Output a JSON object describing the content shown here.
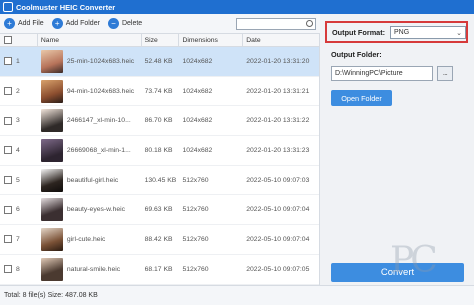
{
  "app": {
    "title": "Coolmuster HEIC Converter"
  },
  "toolbar": {
    "add_file": "Add File",
    "add_folder": "Add Folder",
    "delete": "Delete",
    "search_placeholder": ""
  },
  "table": {
    "headers": {
      "name": "Name",
      "size": "Size",
      "dimensions": "Dimensions",
      "date": "Date"
    },
    "rows": [
      {
        "index": "1",
        "name": "25-min-1024x683.heic",
        "size": "52.48 KB",
        "dimensions": "1024x682",
        "date": "2022-01-20 13:31:20"
      },
      {
        "index": "2",
        "name": "94-min-1024x683.heic",
        "size": "73.74 KB",
        "dimensions": "1024x682",
        "date": "2022-01-20 13:31:21"
      },
      {
        "index": "3",
        "name": "2466147_xl-min-10...",
        "size": "86.70 KB",
        "dimensions": "1024x682",
        "date": "2022-01-20 13:31:22"
      },
      {
        "index": "4",
        "name": "26669068_xl-min-1...",
        "size": "80.18 KB",
        "dimensions": "1024x682",
        "date": "2022-01-20 13:31:23"
      },
      {
        "index": "5",
        "name": "beautiful-girl.heic",
        "size": "130.45 KB",
        "dimensions": "512x760",
        "date": "2022-05-10 09:07:03"
      },
      {
        "index": "6",
        "name": "beauty-eyes-w.heic",
        "size": "69.63 KB",
        "dimensions": "512x760",
        "date": "2022-05-10 09:07:04"
      },
      {
        "index": "7",
        "name": "girl-cute.heic",
        "size": "88.42 KB",
        "dimensions": "512x760",
        "date": "2022-05-10 09:07:04"
      },
      {
        "index": "8",
        "name": "natural-smile.heic",
        "size": "68.17 KB",
        "dimensions": "512x760",
        "date": "2022-05-10 09:07:05"
      }
    ]
  },
  "status": {
    "text": "Total: 8 file(s) Size: 487.08 KB"
  },
  "panel": {
    "output_format_label": "Output Format:",
    "output_format_value": "PNG",
    "output_folder_label": "Output Folder:",
    "output_folder_path": "D:\\WinningPC\\Picture",
    "browse_label": "...",
    "open_folder_label": "Open Folder",
    "convert_label": "Convert"
  },
  "watermark": "PC",
  "colors": {
    "titlebar": "#1f6fd0",
    "accent": "#3d8de0",
    "selected_row": "#cfe3f8",
    "highlight_border": "#d63a3a"
  }
}
